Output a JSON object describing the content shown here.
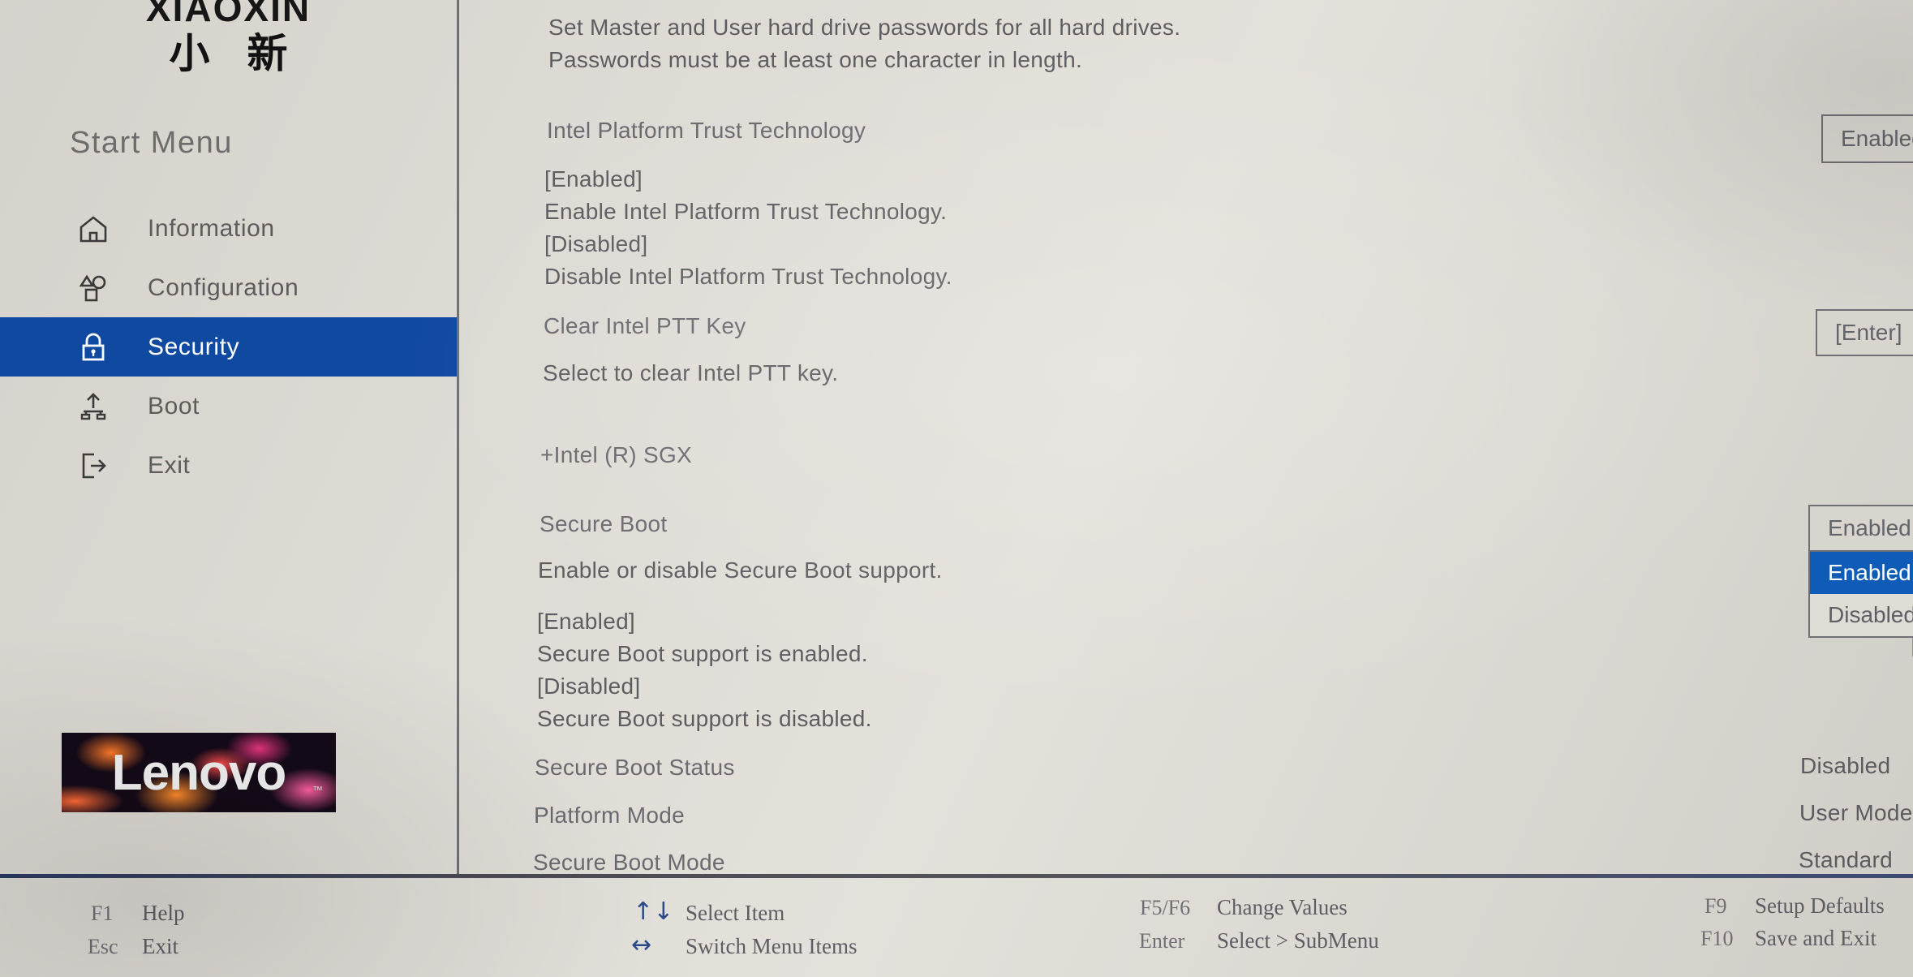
{
  "brand": {
    "latin": "XIAOXIN",
    "cjk": "小新",
    "logo_text": "Lenovo",
    "logo_tm": "™"
  },
  "sidebar": {
    "title": "Start Menu",
    "items": [
      {
        "label": "Information",
        "icon": "home-icon",
        "active": false
      },
      {
        "label": "Configuration",
        "icon": "shapes-icon",
        "active": false
      },
      {
        "label": "Security",
        "icon": "lock-icon",
        "active": true
      },
      {
        "label": "Boot",
        "icon": "boot-upload-icon",
        "active": false
      },
      {
        "label": "Exit",
        "icon": "exit-arrow-icon",
        "active": false
      }
    ]
  },
  "main": {
    "top_help_line1": "Set Master and User hard drive passwords for all hard drives.",
    "top_help_line2": "Passwords must be at least one character in length.",
    "ptt": {
      "label": "Intel Platform Trust Technology",
      "value": "Enabled",
      "help": [
        "[Enabled]",
        "Enable Intel Platform Trust Technology.",
        "[Disabled]",
        "Disable Intel Platform Trust Technology."
      ]
    },
    "clear_ptt": {
      "label": "Clear Intel PTT Key",
      "value": "[Enter]",
      "help": "Select to clear Intel PTT key."
    },
    "sgx": {
      "label": "+Intel (R) SGX"
    },
    "secure_boot": {
      "label": "Secure Boot",
      "value": "Enabled",
      "help": "Enable or disable Secure Boot support.",
      "help_detail": [
        "[Enabled]",
        "Secure Boot support is enabled.",
        "[Disabled]",
        "Secure Boot support is disabled."
      ],
      "options": [
        {
          "label": "Enabled",
          "selected": true
        },
        {
          "label": "Disabled",
          "selected": false
        }
      ]
    },
    "status_rows": [
      {
        "label": "Secure Boot Status",
        "value": "Disabled"
      },
      {
        "label": "Platform Mode",
        "value": "User Mode"
      },
      {
        "label": "Secure Boot Mode",
        "value": "Standard"
      }
    ]
  },
  "footer": {
    "col1": [
      {
        "key": "F1",
        "label": "Help"
      },
      {
        "key": "Esc",
        "label": "Exit"
      }
    ],
    "col2": [
      {
        "icon": "up-down-arrow-icon",
        "glyph": "↑↓",
        "label": "Select Item"
      },
      {
        "icon": "left-right-arrow-icon",
        "glyph": "↔",
        "label": "Switch Menu Items"
      }
    ],
    "col3": [
      {
        "key": "F5/F6",
        "label": "Change Values"
      },
      {
        "key": "Enter",
        "label": "Select > SubMenu"
      }
    ],
    "col4": [
      {
        "key": "F9",
        "label": "Setup Defaults"
      },
      {
        "key": "F10",
        "label": "Save and Exit"
      }
    ]
  },
  "colors": {
    "sidebar_active": "#1049a0",
    "dropdown_selected": "#0f5cb8",
    "background": "#dcdad3",
    "divider": "#6f7176"
  }
}
